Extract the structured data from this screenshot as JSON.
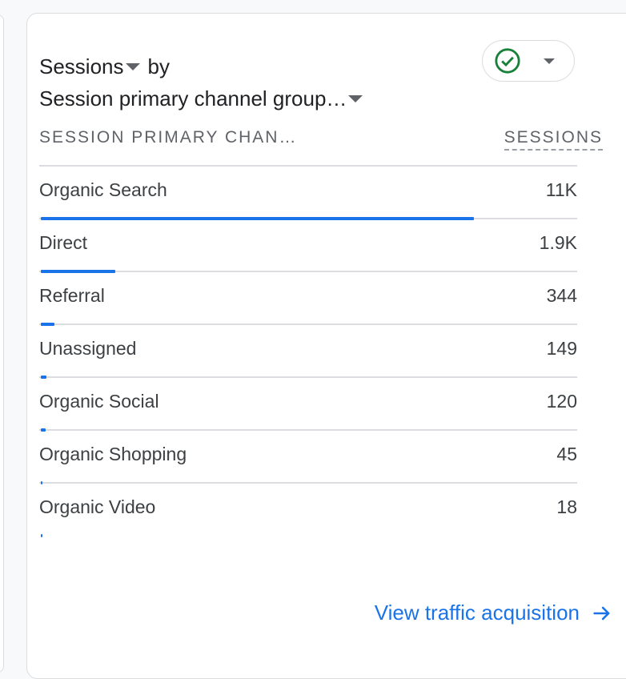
{
  "card": {
    "metric_label": "Sessions",
    "by_label": "by",
    "dimension_label": "Session primary channel group…",
    "status_icon": "check-circle-icon"
  },
  "table": {
    "col_dimension": "SESSION PRIMARY CHAN…",
    "col_metric": "SESSIONS",
    "rows": [
      {
        "label": "Organic Search",
        "value": "11K",
        "fraction": 0.807
      },
      {
        "label": "Direct",
        "value": "1.9K",
        "fraction": 0.139
      },
      {
        "label": "Referral",
        "value": "344",
        "fraction": 0.025
      },
      {
        "label": "Unassigned",
        "value": "149",
        "fraction": 0.011
      },
      {
        "label": "Organic Social",
        "value": "120",
        "fraction": 0.009
      },
      {
        "label": "Organic Shopping",
        "value": "45",
        "fraction": 0.0033
      },
      {
        "label": "Organic Video",
        "value": "18",
        "fraction": 0.0013
      }
    ]
  },
  "footer": {
    "link_label": "View traffic acquisition"
  },
  "colors": {
    "accent": "#1a73e8",
    "success": "#188038"
  }
}
